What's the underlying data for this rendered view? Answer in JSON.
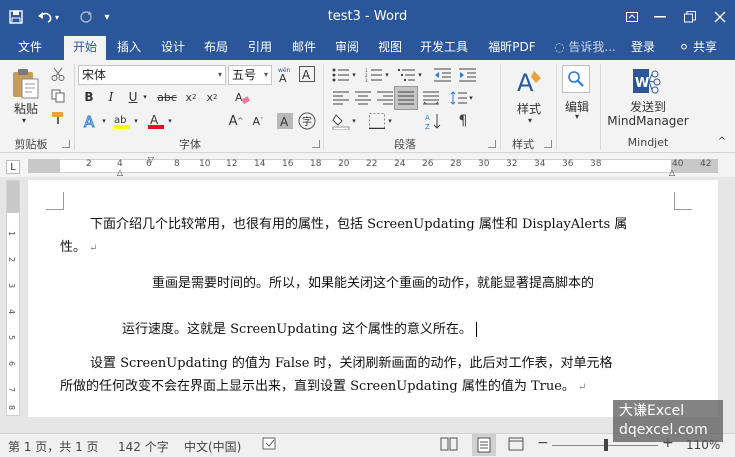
{
  "window": {
    "title": "test3 - Word",
    "save_icon": "save-icon",
    "undo_icon": "undo-icon",
    "redo_icon": "redo-icon"
  },
  "tabs": [
    {
      "label": "文件"
    },
    {
      "label": "开始",
      "active": true
    },
    {
      "label": "插入"
    },
    {
      "label": "设计"
    },
    {
      "label": "布局"
    },
    {
      "label": "引用"
    },
    {
      "label": "邮件"
    },
    {
      "label": "审阅"
    },
    {
      "label": "视图"
    },
    {
      "label": "开发工具"
    },
    {
      "label": "福昕PDF"
    }
  ],
  "tell_me": "告诉我...",
  "sign_in": "登录",
  "share": "共享",
  "ribbon": {
    "clipboard": {
      "paste_label": "粘贴",
      "group_label": "剪贴板"
    },
    "font": {
      "font_name": "宋体",
      "font_size": "五号",
      "group_label": "字体"
    },
    "paragraph": {
      "group_label": "段落"
    },
    "styles": {
      "button_label": "样式",
      "group_label": "样式"
    },
    "editing": {
      "button_label": "编辑"
    },
    "mindjet": {
      "button_label_1": "发送到",
      "button_label_2": "MindManager",
      "group_label": "Mindjet"
    }
  },
  "ruler": {
    "numbers": [
      "2",
      "4",
      "6",
      "8",
      "10",
      "12",
      "14",
      "16",
      "18",
      "20",
      "22",
      "24",
      "26",
      "28",
      "30",
      "32",
      "34",
      "36",
      "38",
      "40",
      "42"
    ],
    "vnumbers": [
      "1",
      "2",
      "3",
      "4",
      "5",
      "6",
      "7",
      "8"
    ]
  },
  "document": {
    "paragraphs": [
      {
        "line1": "下面介绍几个比较常用，也很有用的属性，包括 ScreenUpdating 属性和 DisplayAlerts 属",
        "line2": "性。"
      },
      {
        "line1": "重画是需要时间的。所以，如果能关闭这个重画的动作，就能显著提高脚本的"
      },
      {
        "line1": "运行速度。这就是 ScreenUpdating 这个属性的意义所在。"
      },
      {
        "line1": "设置 ScreenUpdating 的值为 False 时，关闭刷新画面的动作，此后对工作表，对单元格",
        "line2": "所做的任何改变不会在界面上显示出来，直到设置 ScreenUpdating 属性的值为 True。"
      }
    ]
  },
  "status": {
    "page": "第 1 页，共 1 页",
    "words": "142 个字",
    "language": "中文(中国)",
    "zoom": "110%"
  },
  "watermark": {
    "line1": "大谦Excel",
    "line2": "dqexcel.com"
  },
  "colors": {
    "brand": "#2b579a",
    "highlight": "#ffff00",
    "font_color": "#e81123"
  }
}
